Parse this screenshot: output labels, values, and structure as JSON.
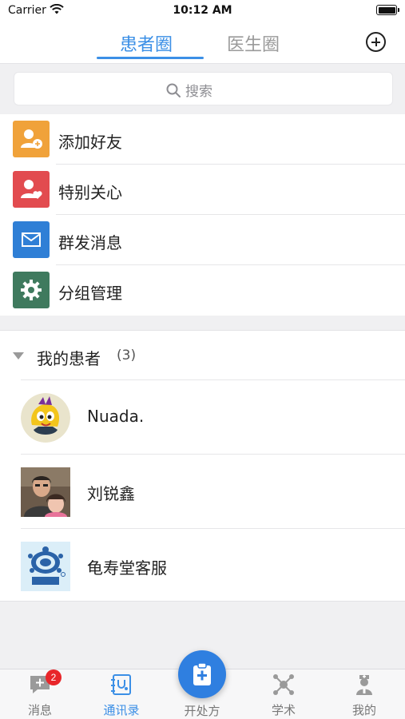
{
  "status_bar": {
    "carrier": "Carrier",
    "time": "10:12 AM"
  },
  "top_tabs": {
    "patients": "患者圈",
    "doctors": "医生圈",
    "active_color": "#3b8fe6"
  },
  "search": {
    "placeholder": "搜索"
  },
  "menu": [
    {
      "label": "添加好友",
      "icon": "add-friend-icon",
      "color": "#f0a23a"
    },
    {
      "label": "特别关心",
      "icon": "heart-user-icon",
      "color": "#e24b4f"
    },
    {
      "label": "群发消息",
      "icon": "envelope-icon",
      "color": "#2f7fd6"
    },
    {
      "label": "分组管理",
      "icon": "gear-icon",
      "color": "#3f7a5e"
    }
  ],
  "patient_group": {
    "title": "我的患者",
    "count": "(3)",
    "contacts": [
      {
        "name": "Nuada.",
        "avatar": "cartoon-avatar"
      },
      {
        "name": "刘锐鑫",
        "avatar": "photo-avatar"
      },
      {
        "name": "龟寿堂客服",
        "avatar": "logo-avatar"
      }
    ]
  },
  "tab_bar": {
    "messages": "消息",
    "messages_badge": "2",
    "contacts": "通讯录",
    "prescribe": "开处方",
    "academic": "学术",
    "mine": "我的"
  }
}
